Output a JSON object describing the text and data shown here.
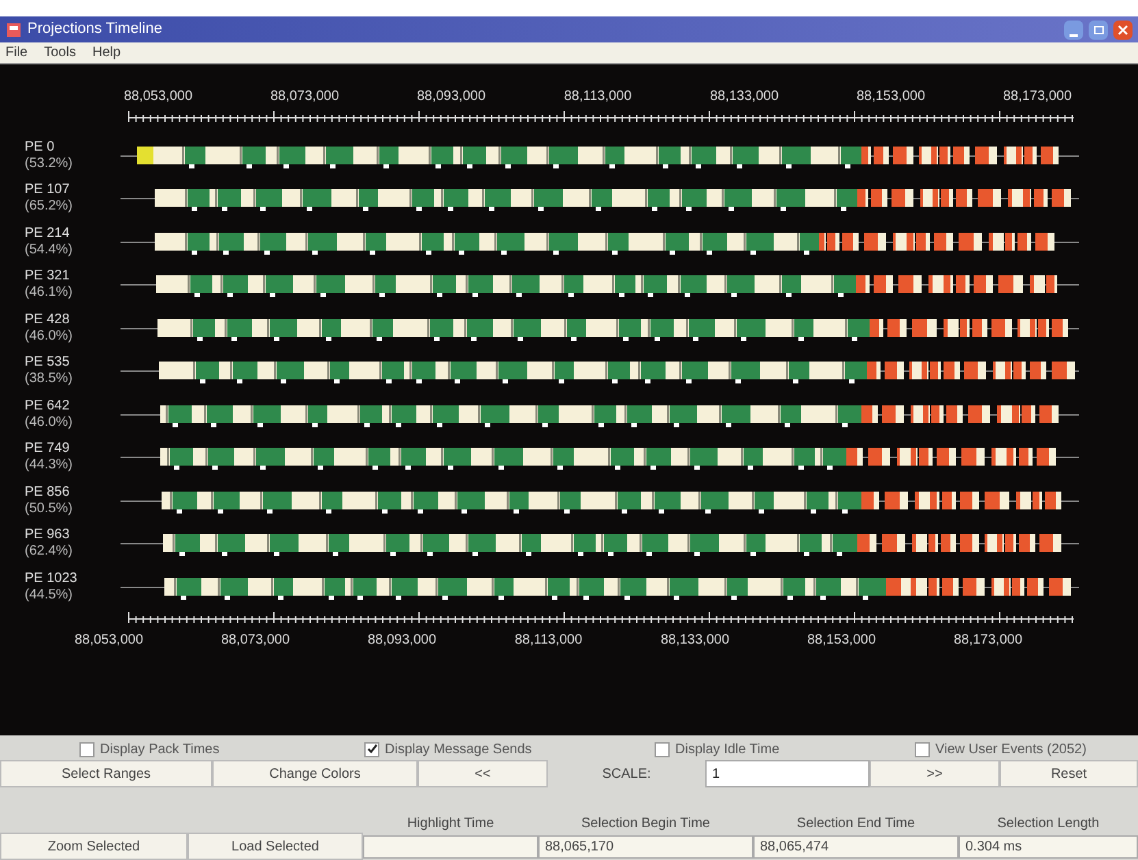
{
  "window": {
    "title": "Projections Timeline"
  },
  "menu": [
    "File",
    "Tools",
    "Help"
  ],
  "top_axis_labels": [
    "88,053,000",
    "88,073,000",
    "88,093,000",
    "88,113,000",
    "88,133,000",
    "88,153,000",
    "88,173,000"
  ],
  "bottom_axis_labels": [
    "88,053,000",
    "88,073,000",
    "88,093,000",
    "88,113,000",
    "88,133,000",
    "88,153,000",
    "88,173,000"
  ],
  "processors": [
    {
      "name": "PE 0",
      "usage": "(53.2%)"
    },
    {
      "name": "PE 107",
      "usage": "(65.2%)"
    },
    {
      "name": "PE 214",
      "usage": "(54.4%)"
    },
    {
      "name": "PE 321",
      "usage": "(46.1%)"
    },
    {
      "name": "PE 428",
      "usage": "(46.0%)"
    },
    {
      "name": "PE 535",
      "usage": "(38.5%)"
    },
    {
      "name": "PE 642",
      "usage": "(46.0%)"
    },
    {
      "name": "PE 749",
      "usage": "(44.3%)"
    },
    {
      "name": "PE 856",
      "usage": "(50.5%)"
    },
    {
      "name": "PE 963",
      "usage": "(62.4%)"
    },
    {
      "name": "PE 1023",
      "usage": "(44.5%)"
    }
  ],
  "options": [
    {
      "label": "Display Pack Times",
      "checked": false
    },
    {
      "label": "Display Message Sends",
      "checked": true
    },
    {
      "label": "Display Idle Time",
      "checked": false
    },
    {
      "label": "View User Events (2052)",
      "checked": false
    }
  ],
  "controls": {
    "select_ranges": "Select Ranges",
    "change_colors": "Change Colors",
    "zoom_out": "<<",
    "scale_label": "SCALE:",
    "scale_value": "1",
    "zoom_in": ">>",
    "reset": "Reset"
  },
  "selection": {
    "zoom_selected": "Zoom Selected",
    "load_selected": "Load Selected",
    "fields": [
      {
        "label": "Highlight Time"
      },
      {
        "label": "Selection Begin Time",
        "value": "88,065,170"
      },
      {
        "label": "Selection End Time",
        "value": "88,065,474"
      },
      {
        "label": "Selection Length",
        "value": "0.304 ms"
      }
    ]
  }
}
